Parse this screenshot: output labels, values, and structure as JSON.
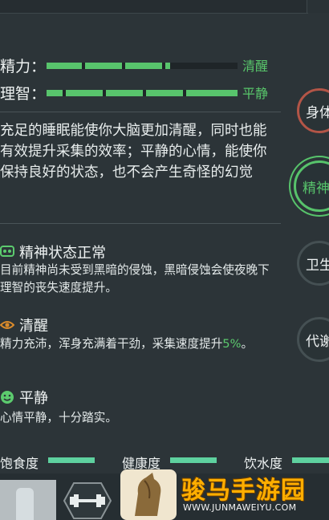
{
  "stats": [
    {
      "label": "精力：",
      "value": "清醒",
      "filled": 4,
      "segments": 5
    },
    {
      "label": "理智：",
      "value": "平静",
      "filled": 5,
      "segments": 5
    }
  ],
  "description": "充足的睡眠能使你大脑更加清醒，同时也能有效提升采集的效率；平静的心情，能使你保持良好的状态，也不会产生奇怪的幻觉",
  "statuses": [
    {
      "icon": "brain-mask-icon",
      "title": "精神状态正常",
      "desc": "目前精神尚未受到黑暗的侵蚀，黑暗侵蚀会使夜晚下理智的丧失速度提升。"
    },
    {
      "icon": "eye-icon",
      "title": "清醒",
      "desc_a": "精力充沛，浑身充满着干劲，采集速度提升",
      "desc_b": "5%",
      "desc_c": "。"
    },
    {
      "icon": "smile-icon",
      "title": "平静",
      "desc": "心情平静，十分踏实。"
    }
  ],
  "side_buttons": [
    {
      "label": "身体",
      "state": "alert"
    },
    {
      "label": "精神",
      "state": "active"
    },
    {
      "label": "卫生",
      "state": "normal"
    },
    {
      "label": "代谢",
      "state": "normal"
    }
  ],
  "gauges": [
    {
      "label": "饱食度",
      "level": 0.8
    },
    {
      "label": "健康度",
      "level": 0.85
    },
    {
      "label": "饮水度",
      "level": 0.75
    }
  ],
  "watermark": {
    "title": "骏马手游园",
    "url": "WWW.JUNMAWEIYU.COM"
  },
  "colors": {
    "accent": "#58c46c",
    "gauge": "#5ed19f",
    "alert": "#b35547",
    "watermark": "#ffae00"
  }
}
